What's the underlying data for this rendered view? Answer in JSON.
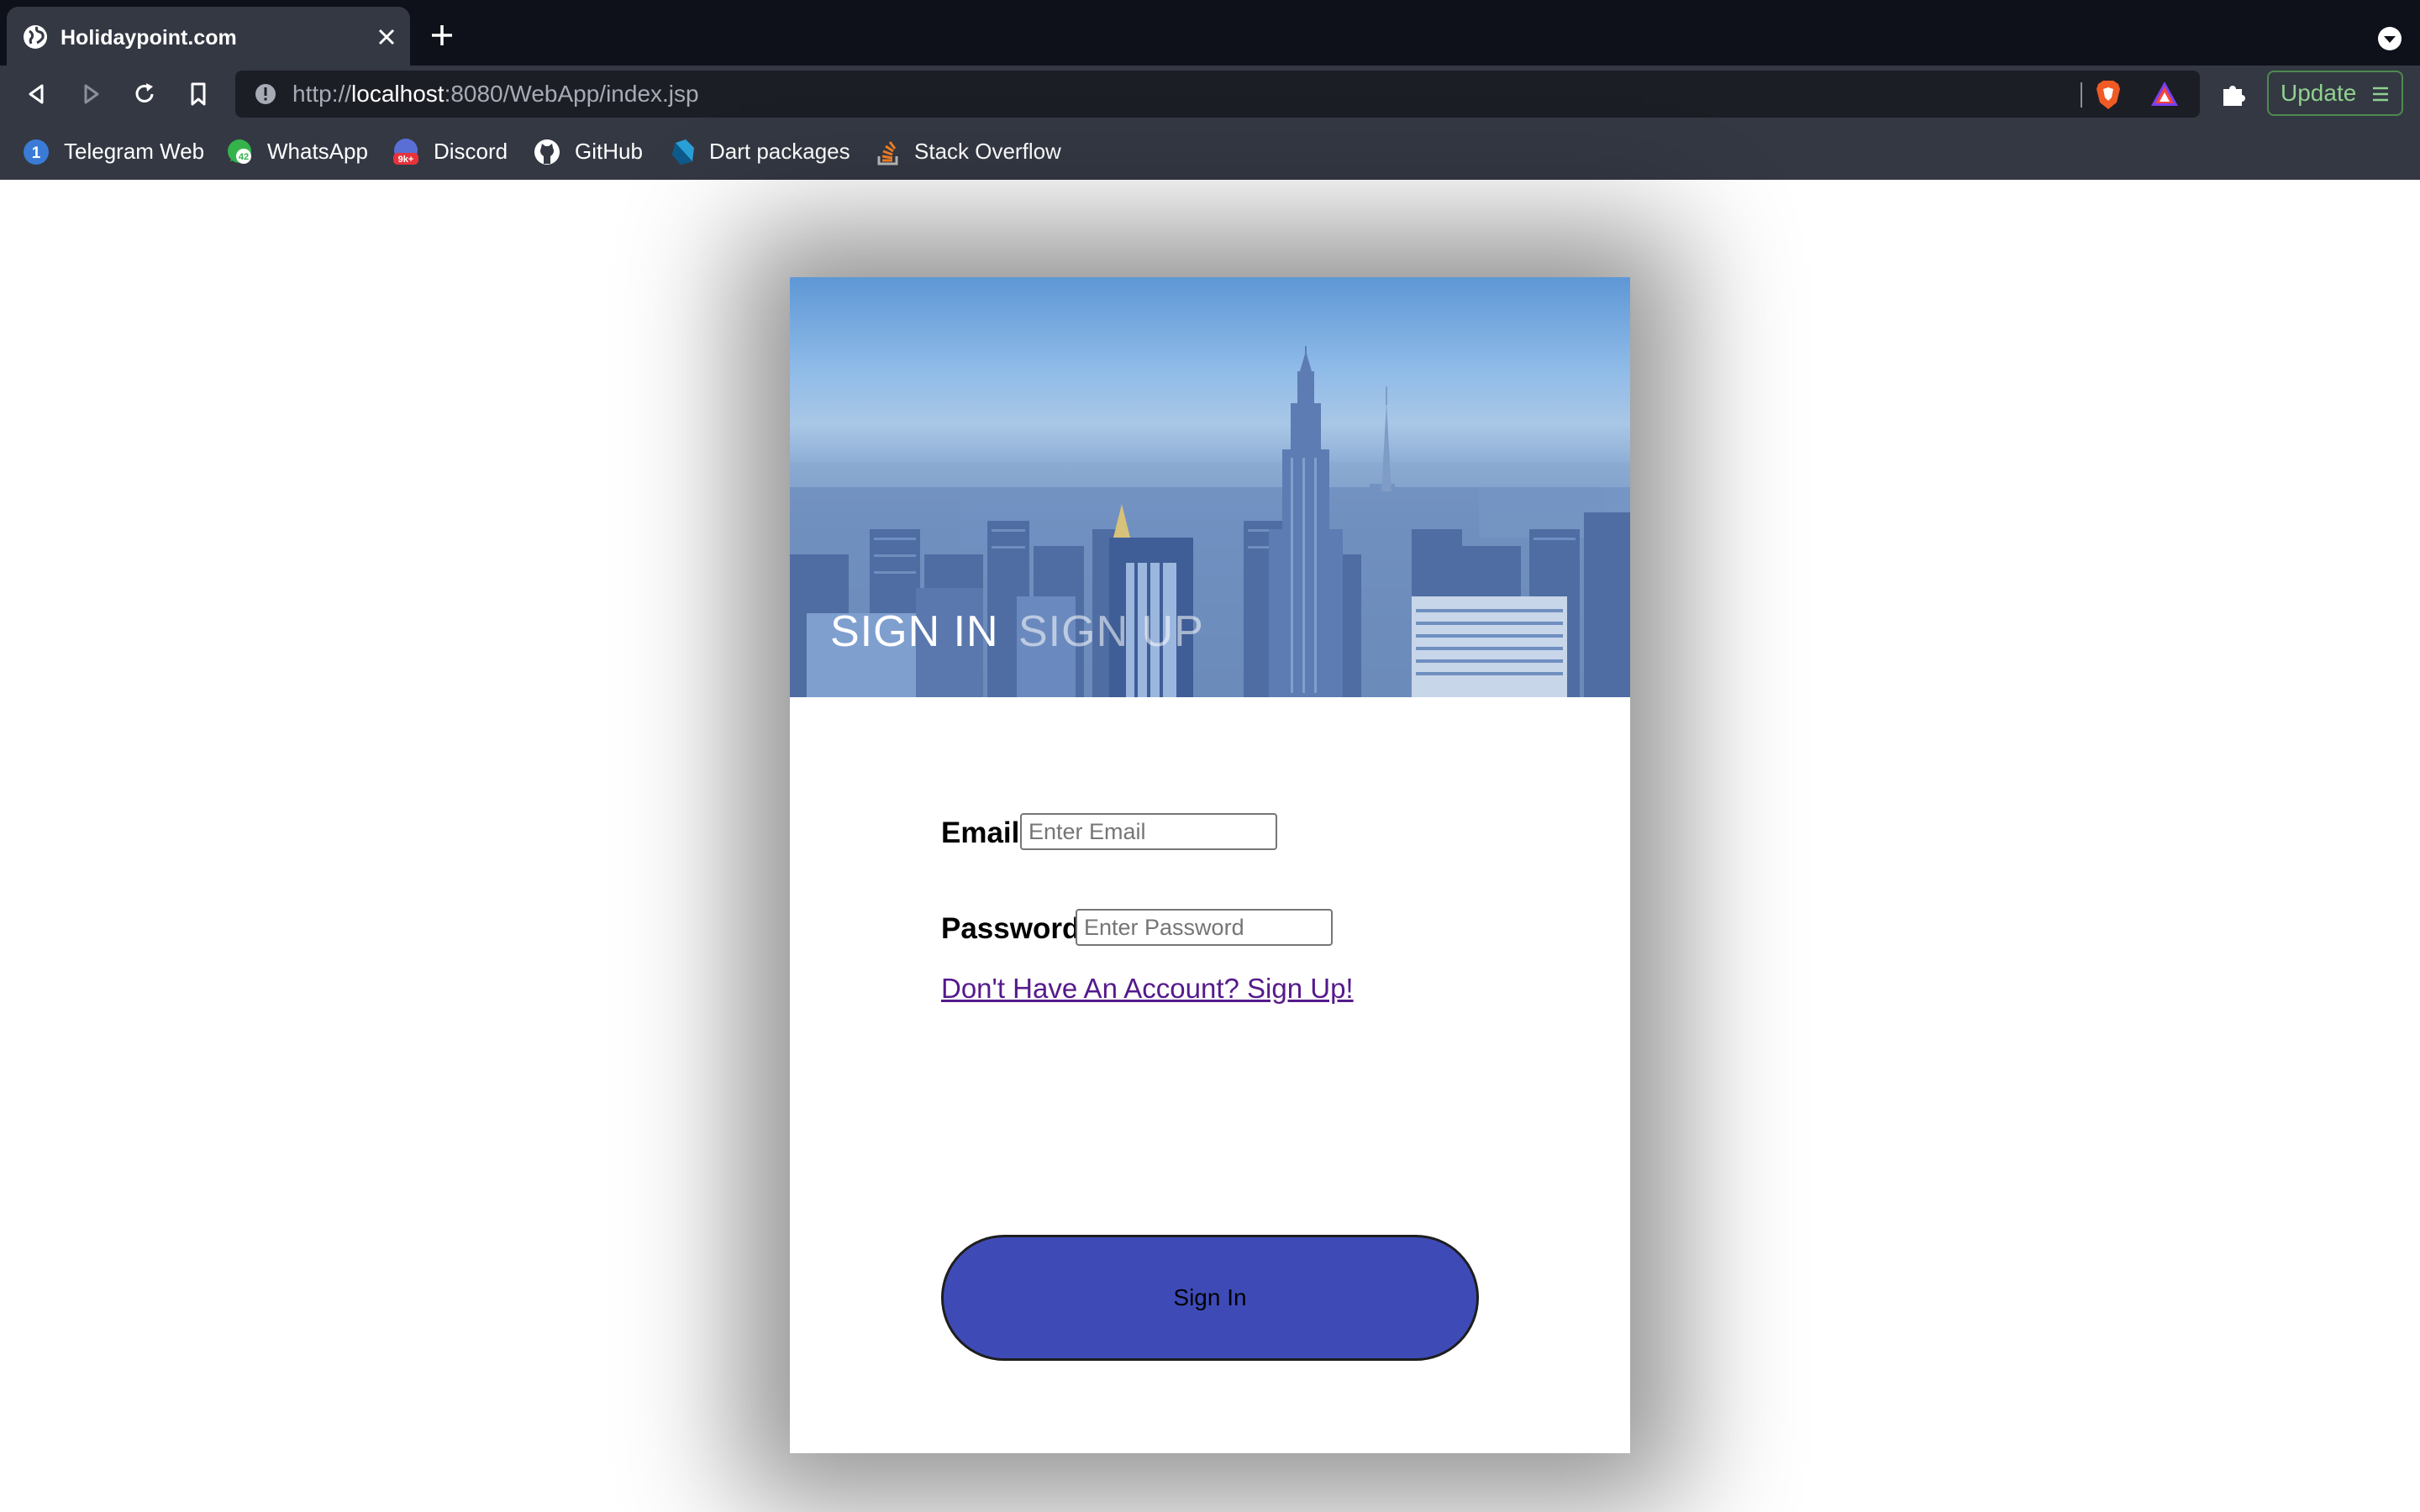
{
  "browser": {
    "tab": {
      "title": "Holidaypoint.com"
    },
    "url": {
      "scheme": "http://",
      "host": "localhost",
      "rest": ":8080/WebApp/index.jsp"
    },
    "update_label": "Update",
    "bookmarks": [
      {
        "label": "Telegram Web",
        "icon": "telegram-icon"
      },
      {
        "label": "WhatsApp",
        "icon": "whatsapp-icon"
      },
      {
        "label": "Discord",
        "icon": "discord-icon"
      },
      {
        "label": "GitHub",
        "icon": "github-icon"
      },
      {
        "label": "Dart packages",
        "icon": "dart-icon"
      },
      {
        "label": "Stack Overflow",
        "icon": "stackoverflow-icon"
      }
    ],
    "badges": {
      "telegram": "1",
      "whatsapp": "42",
      "discord": "9k+"
    }
  },
  "page": {
    "tabs": {
      "signin": "SIGN IN",
      "signup": "SIGN UP"
    },
    "form": {
      "email_label": "Email",
      "email_placeholder": "Enter Email",
      "password_label": "Password",
      "password_placeholder": "Enter Password",
      "signup_link": "Don't Have An Account? Sign Up!",
      "submit_label": "Sign In"
    }
  },
  "colors": {
    "button": "#3e4bb7",
    "link": "#551a8b",
    "chrome": "#343843"
  }
}
